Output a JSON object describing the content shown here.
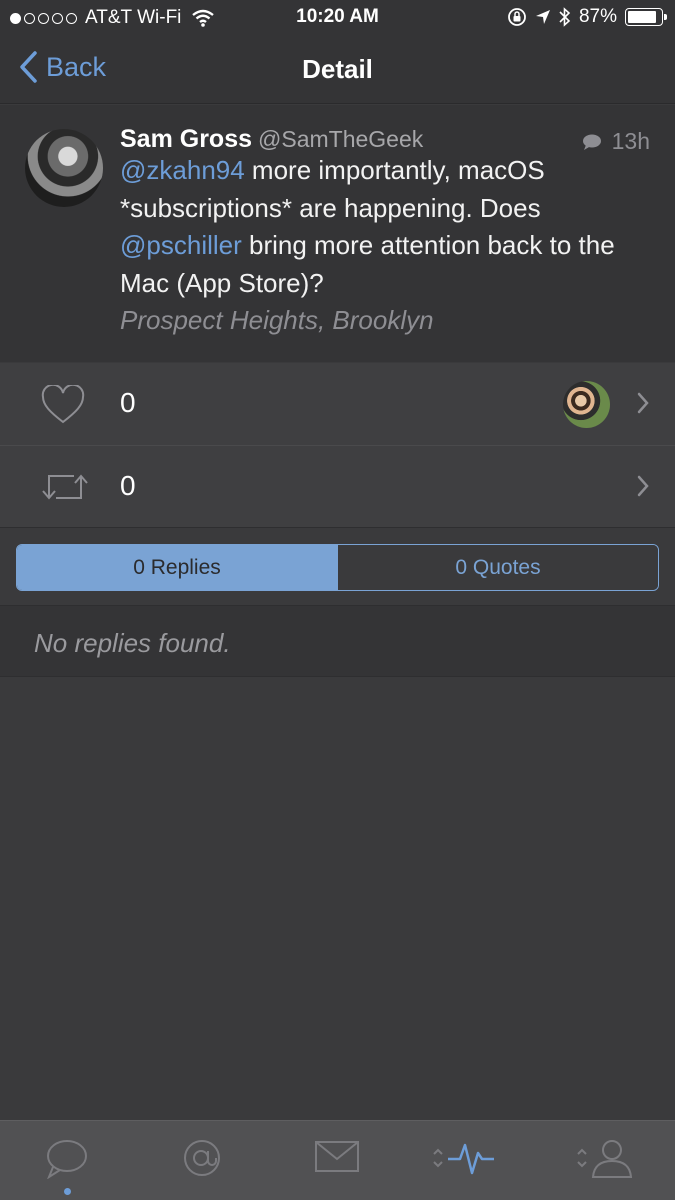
{
  "status_bar": {
    "carrier": "AT&T Wi-Fi",
    "time": "10:20 AM",
    "battery": "87%",
    "battery_level": 0.87,
    "signal_bars_filled": 1,
    "signal_bars_total": 5
  },
  "nav": {
    "back_label": "Back",
    "title": "Detail"
  },
  "tweet": {
    "author_name": "Sam Gross",
    "author_handle": "@SamTheGeek",
    "time": "13h",
    "mention_1": "@zkahn94",
    "text_1": " more importantly, macOS *subscriptions* are happening. Does ",
    "mention_2": "@pschiller",
    "text_2": " bring more attention back to the Mac (App Store)?",
    "location": "Prospect Heights, Brooklyn"
  },
  "stats": {
    "likes": "0",
    "retweets": "0"
  },
  "segments": {
    "replies": "0 Replies",
    "quotes": "0 Quotes",
    "active": "replies"
  },
  "empty_state": "No replies found.",
  "tab_bar": {
    "tabs": [
      "timeline-icon",
      "mentions-icon",
      "messages-icon",
      "activity-icon",
      "profile-icon"
    ],
    "active_tab": "timeline"
  },
  "colors": {
    "accent": "#6d9dd8",
    "background": "#3a3a3c",
    "tab_bar": "#515153"
  }
}
